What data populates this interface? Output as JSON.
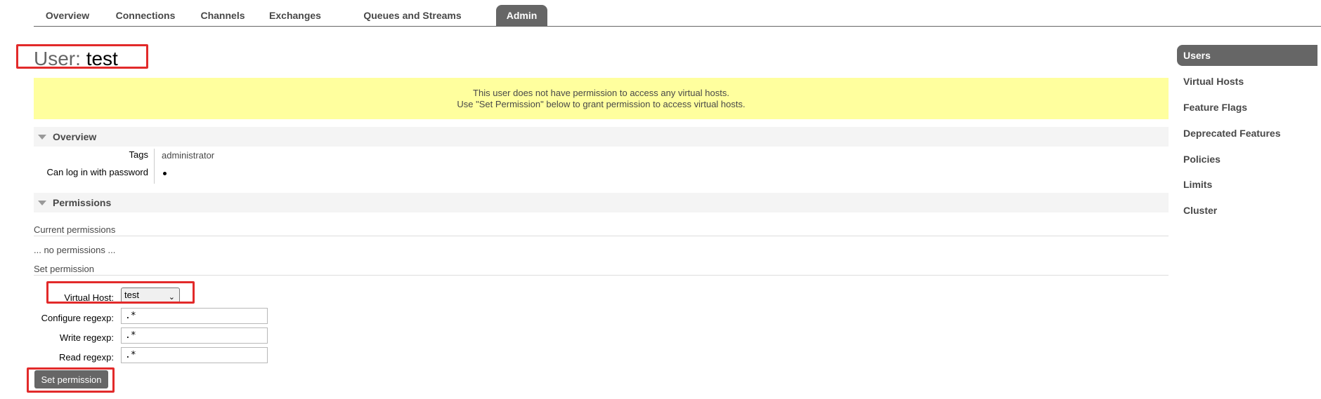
{
  "tabs": [
    {
      "label": "Overview",
      "active": false
    },
    {
      "label": "Connections",
      "active": false
    },
    {
      "label": "Channels",
      "active": false
    },
    {
      "label": "Exchanges",
      "active": false
    },
    {
      "label": "Queues and Streams",
      "active": false
    },
    {
      "label": "Admin",
      "active": true
    }
  ],
  "title": {
    "prefix": "User:",
    "name": "test"
  },
  "warning": {
    "line1": "This user does not have permission to access any virtual hosts.",
    "line2": "Use \"Set Permission\" below to grant permission to access virtual hosts."
  },
  "overview": {
    "heading": "Overview",
    "rows": [
      {
        "label": "Tags",
        "value": "administrator"
      },
      {
        "label": "Can log in with password",
        "value": "•"
      }
    ]
  },
  "permissions": {
    "heading": "Permissions",
    "current_heading": "Current permissions",
    "empty_text": "... no permissions ...",
    "set_heading": "Set permission",
    "vhost_label": "Virtual Host:",
    "vhost_value": "test",
    "configure_label": "Configure regexp:",
    "configure_value": ".*",
    "write_label": "Write regexp:",
    "write_value": ".*",
    "read_label": "Read regexp:",
    "read_value": ".*",
    "submit_label": "Set permission"
  },
  "sidebar": [
    {
      "label": "Users",
      "active": true
    },
    {
      "label": "Virtual Hosts",
      "active": false
    },
    {
      "label": "Feature Flags",
      "active": false
    },
    {
      "label": "Deprecated Features",
      "active": false
    },
    {
      "label": "Policies",
      "active": false
    },
    {
      "label": "Limits",
      "active": false
    },
    {
      "label": "Cluster",
      "active": false
    }
  ],
  "colors": {
    "accent": "#666666",
    "warning_bg": "#ffff9e",
    "highlight_box": "#e22a2a"
  }
}
